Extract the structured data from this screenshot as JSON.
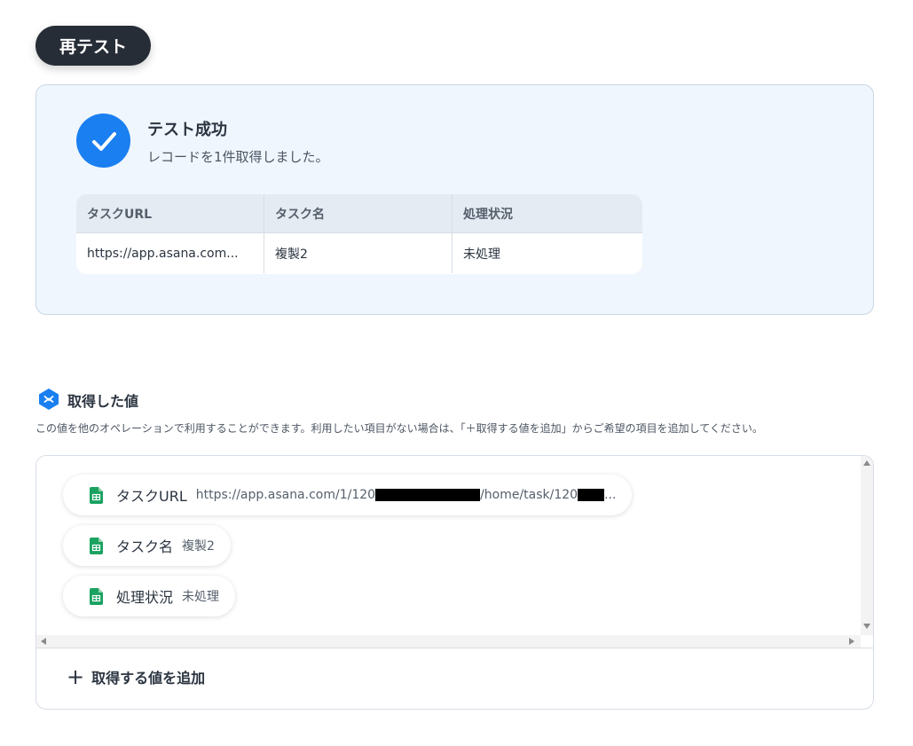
{
  "retest_button": "再テスト",
  "result": {
    "title": "テスト成功",
    "subtitle": "レコードを1件取得しました。",
    "table": {
      "headers": [
        "タスクURL",
        "タスク名",
        "処理状況"
      ],
      "rows": [
        [
          "https://app.asana.com...",
          "複製2",
          "未処理"
        ]
      ]
    }
  },
  "values_section": {
    "title": "取得した値",
    "description": "この値を他のオペレーションで利用することができます。利用したい項目がない場合は、「＋取得する値を追加」からご希望の項目を追加してください。",
    "items": [
      {
        "label": "タスクURL",
        "value_prefix": "https://app.asana.com/1/120",
        "value_mid": "/home/task/120",
        "value_suffix": "..."
      },
      {
        "label": "タスク名",
        "value": "複製2"
      },
      {
        "label": "処理状況",
        "value": "未処理"
      }
    ],
    "add_button": "取得する値を追加"
  },
  "colors": {
    "accent": "#1a7ff0",
    "dark_button": "#272d36",
    "sheet_icon_green": "#1aa260"
  },
  "icons": {
    "success": "check-icon",
    "section": "yoom-logo-icon",
    "item": "spreadsheet-icon",
    "add": "plus-icon"
  }
}
